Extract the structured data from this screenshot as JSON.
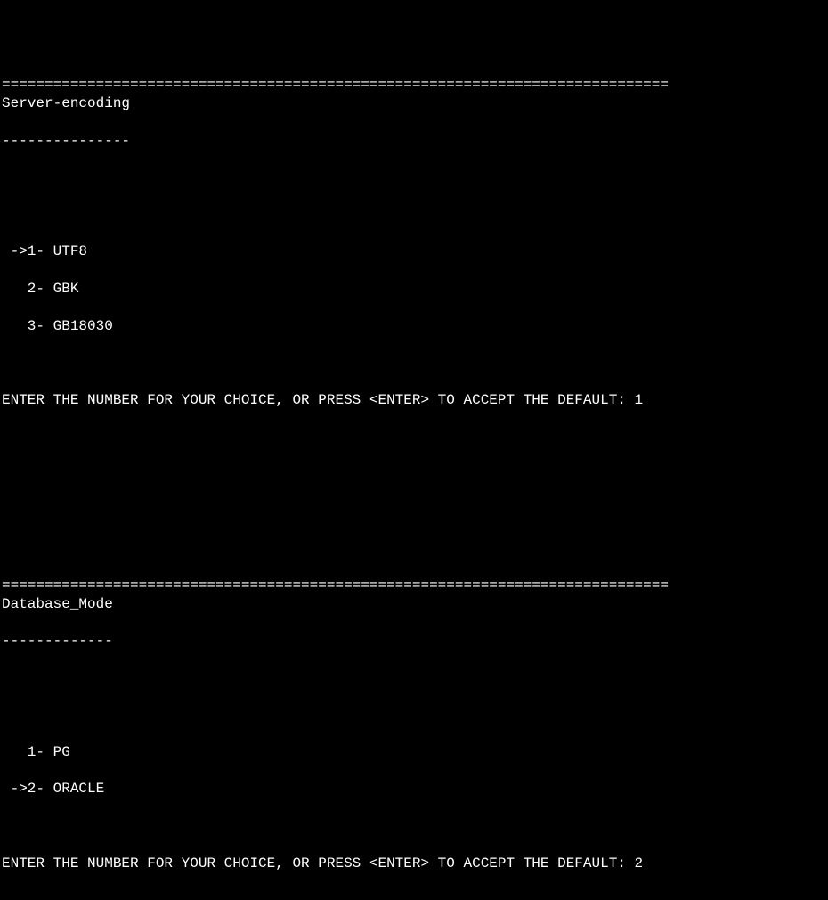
{
  "rule_top": "==============================================================================",
  "section1": {
    "title": "Server-encoding",
    "underline": "---------------",
    "options": [
      {
        "line": " ->1- UTF8"
      },
      {
        "line": "   2- GBK"
      },
      {
        "line": "   3- GB18030"
      }
    ],
    "prompt": "ENTER THE NUMBER FOR YOUR CHOICE, OR PRESS <ENTER> TO ACCEPT THE DEFAULT: 1"
  },
  "rule_mid": "==============================================================================",
  "section2": {
    "title": "Database_Mode",
    "underline": "-------------",
    "options": [
      {
        "line": "   1- PG"
      },
      {
        "line": " ->2- ORACLE"
      }
    ],
    "prompt": "ENTER THE NUMBER FOR YOUR CHOICE, OR PRESS <ENTER> TO ACCEPT THE DEFAULT: 2"
  }
}
